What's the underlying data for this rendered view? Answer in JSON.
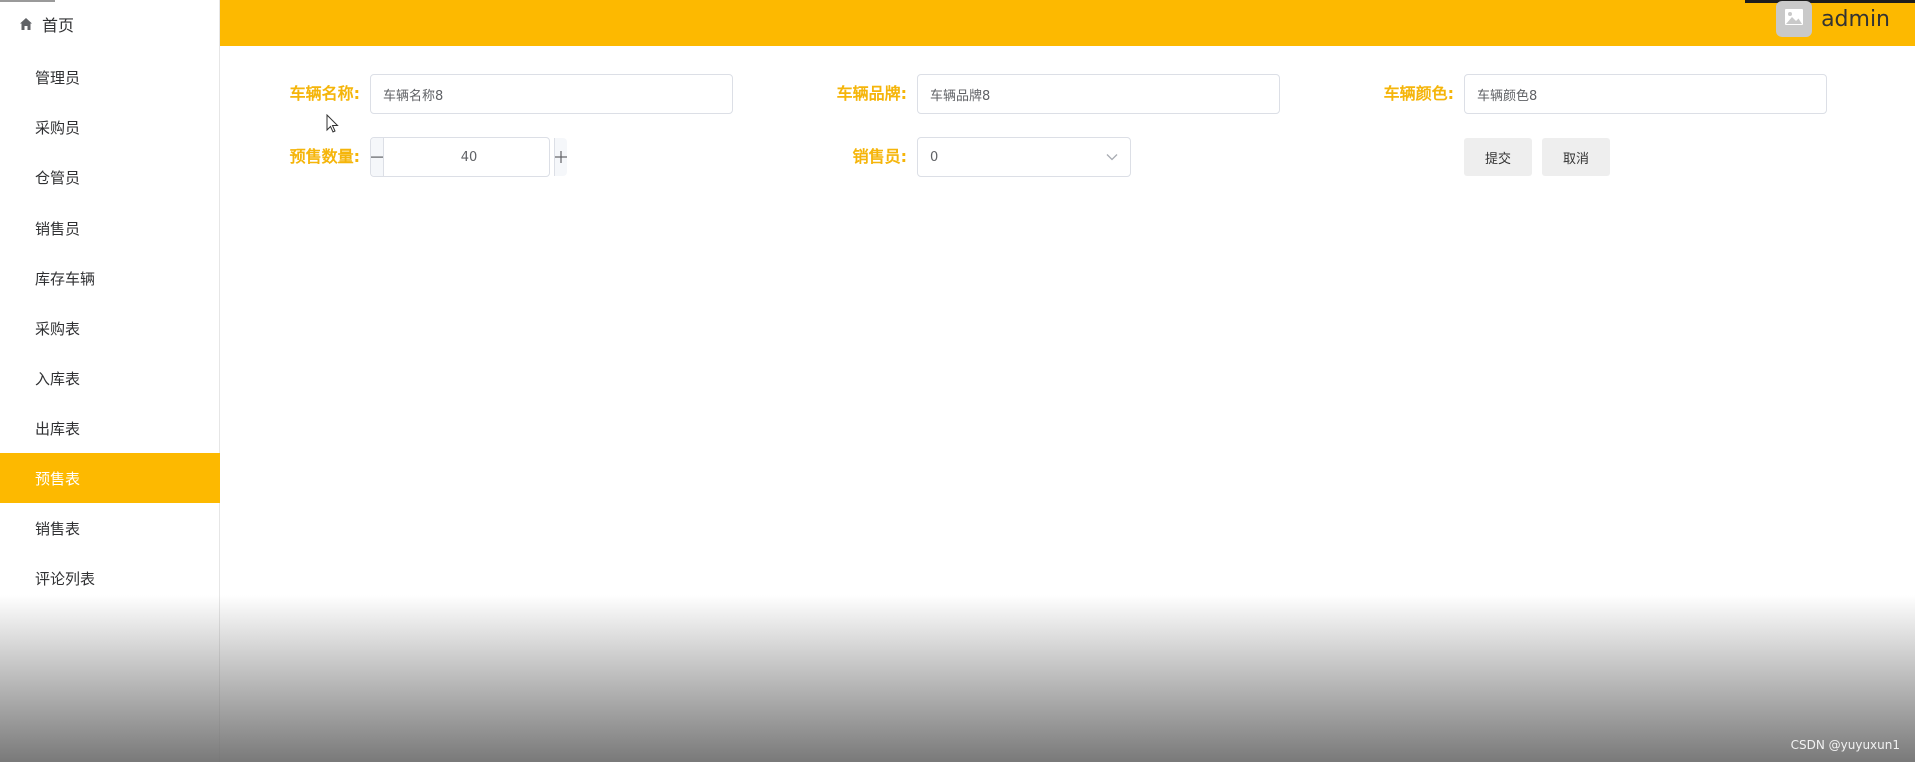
{
  "sidebar": {
    "home_label": "首页",
    "items": [
      {
        "label": "管理员"
      },
      {
        "label": "采购员"
      },
      {
        "label": "仓管员"
      },
      {
        "label": "销售员"
      },
      {
        "label": "库存车辆"
      },
      {
        "label": "采购表"
      },
      {
        "label": "入库表"
      },
      {
        "label": "出库表"
      },
      {
        "label": "预售表",
        "active": true
      },
      {
        "label": "销售表"
      },
      {
        "label": "评论列表"
      }
    ]
  },
  "header": {
    "user_name": "admin",
    "accent_color": "#fdb900"
  },
  "form": {
    "vehicle_name": {
      "label": "车辆名称:",
      "value": "车辆名称8"
    },
    "vehicle_brand": {
      "label": "车辆品牌:",
      "value": "车辆品牌8"
    },
    "vehicle_color": {
      "label": "车辆颜色:",
      "value": "车辆颜色8"
    },
    "presale_quantity": {
      "label": "预售数量:",
      "value": "40"
    },
    "salesperson": {
      "label": "销售员:",
      "value": "0"
    },
    "submit_label": "提交",
    "cancel_label": "取消"
  },
  "icons": {
    "home": "home-icon",
    "avatar": "image-icon",
    "minus": "minus-icon",
    "plus": "plus-icon",
    "dropdown": "chevron-down-icon"
  },
  "watermark": "CSDN @yuyuxun1"
}
